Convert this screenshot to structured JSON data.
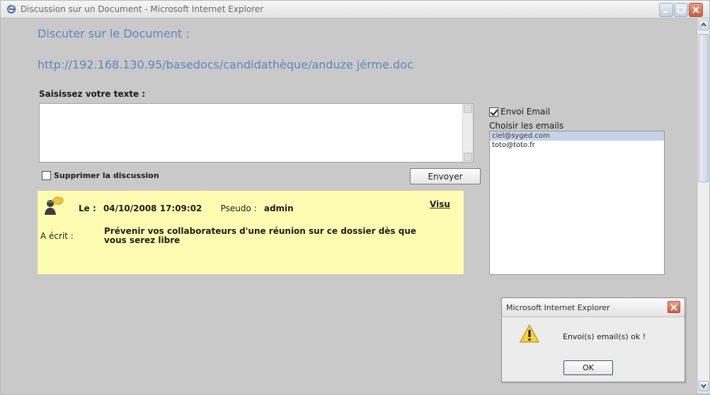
{
  "window": {
    "title": "Discussion sur un Document - Microsoft Internet Explorer"
  },
  "page": {
    "heading": "Discuter sur le Document :",
    "document_url": "http://192.168.130.95/basedocs/candidathèque/anduze jérme.doc",
    "input_label": "Saisissez votre texte :",
    "input_value": "",
    "delete_label": "Supprimer la discussion",
    "delete_checked": false,
    "send_label": "Envoyer"
  },
  "message": {
    "date_label": "Le :",
    "date_value": "04/10/2008 17:09:02",
    "pseudo_label": "Pseudo :",
    "pseudo_value": "admin",
    "visu_label": "Visu",
    "author_label": "A écrit :",
    "body": "Prévenir vos collaborateurs d'une réunion sur ce dossier dès que vous serez libre"
  },
  "email": {
    "send_email_label": "Envoi Email",
    "send_email_checked": true,
    "choose_label": "Choisir les emails",
    "items": [
      {
        "label": "ciel@syged.com",
        "selected": true
      },
      {
        "label": "toto@toto.fr",
        "selected": false
      }
    ]
  },
  "dialog": {
    "title": "Microsoft Internet Explorer",
    "message": "Envoi(s) email(s) ok !",
    "ok_label": "OK",
    "icon": "warning-icon"
  },
  "colors": {
    "link": "#5a87c4",
    "message_background": "#fdfdb2",
    "page_background": "#c9c9c9",
    "selection": "#c5d3e8"
  }
}
